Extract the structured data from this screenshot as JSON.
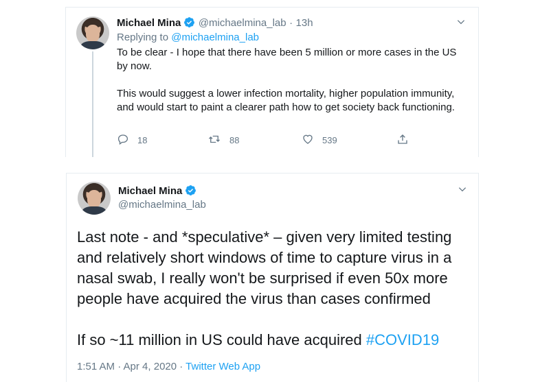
{
  "tweet1": {
    "author_name": "Michael Mina",
    "handle": "@michaelmina_lab",
    "separator": "·",
    "time": "13h",
    "replying_prefix": "Replying to",
    "replying_handle": "@michaelmina_lab",
    "paragraph1": "To be clear - I hope that there have been 5 million or more cases in the US by now.",
    "paragraph2": "This would suggest a lower infection mortality, higher population immunity, and would start to paint a clearer path how to get society back functioning.",
    "reply_count": "18",
    "retweet_count": "88",
    "like_count": "539"
  },
  "tweet2": {
    "author_name": "Michael Mina",
    "handle": "@michaelmina_lab",
    "paragraph1": "Last note - and *speculative* – given very limited testing and relatively short windows of time to capture virus in a nasal swab, I really won't be surprised if even 50x more people have acquired the virus than cases confirmed",
    "paragraph2_text": "If so ~11 million in US could have acquired ",
    "hashtag": "#COVID19",
    "timestamp": "1:51 AM · Apr 4, 2020 · ",
    "source_app": "Twitter Web App"
  },
  "colors": {
    "accent": "#1da1f2",
    "muted": "#657786",
    "text": "#14171a",
    "border": "#e6ecf0"
  },
  "icons": [
    "verified-badge-icon",
    "chevron-down-icon",
    "reply-icon",
    "retweet-icon",
    "like-icon",
    "share-icon"
  ]
}
